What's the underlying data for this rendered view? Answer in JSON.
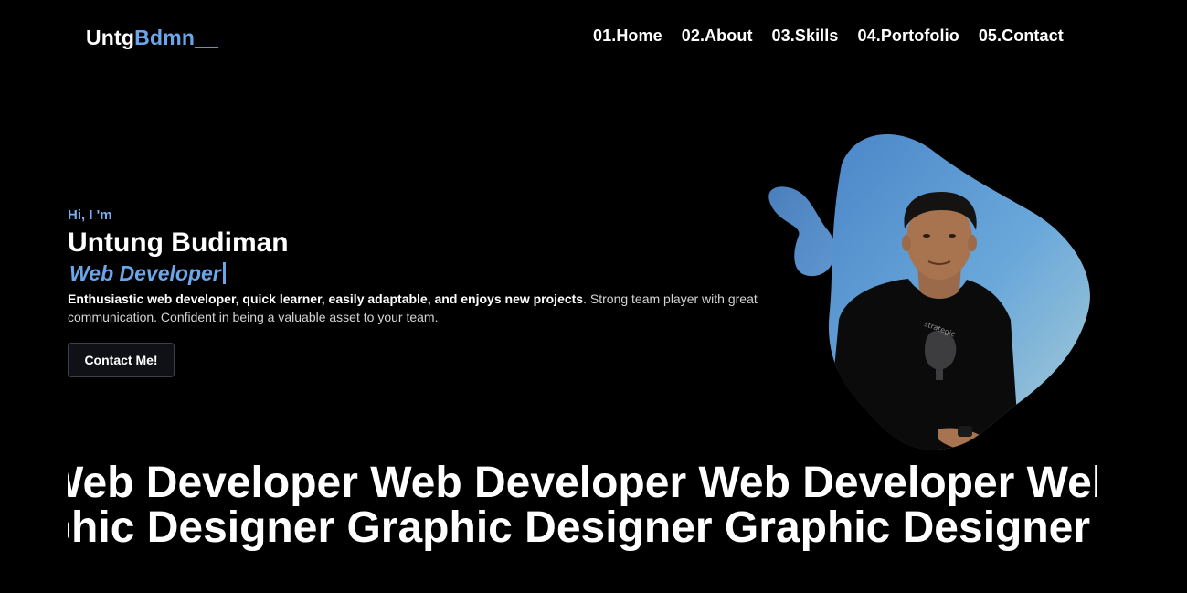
{
  "header": {
    "logo_main": "Untg",
    "logo_accent": "Bdmn__",
    "nav": [
      {
        "label": "01.Home"
      },
      {
        "label": "02.About"
      },
      {
        "label": "03.Skills"
      },
      {
        "label": "04.Portofolio"
      },
      {
        "label": "05.Contact"
      }
    ]
  },
  "hero": {
    "greeting": "Hi, I 'm",
    "name": "Untung Budiman",
    "role": "Web Developer",
    "desc_bold": "Enthusiastic web developer, quick learner, easily adaptable, and enjoys new projects",
    "desc_rest": ". Strong team player with great communication. Confident in being a valuable asset to your team.",
    "cta_label": "Contact Me!"
  },
  "marquee": {
    "line1": "Web Developer Web Developer Web Developer Web Developer",
    "line2": "Graphic Designer Graphic Designer Graphic Designer Graphic"
  },
  "colors": {
    "accent": "#6aa6ea",
    "background": "#000000",
    "blob_gradient_start": "#4b86c8",
    "blob_gradient_end": "#9cc5d6"
  }
}
